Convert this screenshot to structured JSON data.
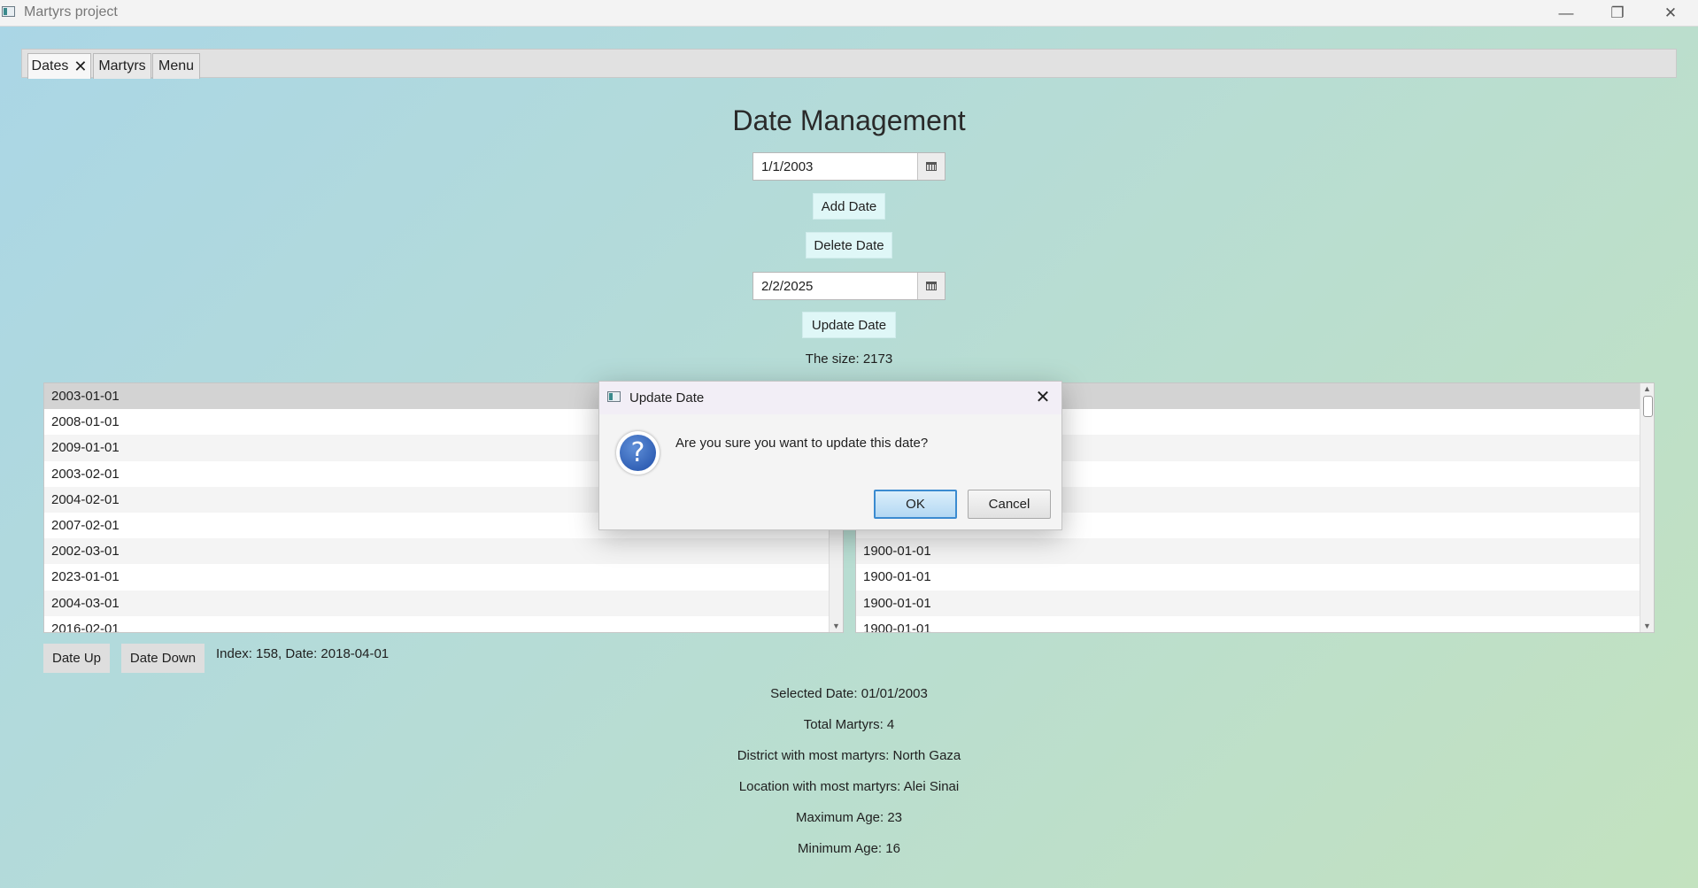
{
  "window": {
    "title": "Martyrs project",
    "controls": {
      "minimize": "—",
      "restore": "❐",
      "close": "✕"
    }
  },
  "tabs": [
    {
      "label": "Dates",
      "close": "✕",
      "active": true
    },
    {
      "label": "Martyrs"
    },
    {
      "label": "Menu"
    }
  ],
  "main": {
    "title": "Date Management",
    "date_input": "1/1/2003",
    "add_button": "Add Date",
    "delete_button": "Delete Date",
    "update_date_input": "2/2/2025",
    "update_button": "Update Date",
    "size_label": "The size: 2173"
  },
  "left_list": [
    "2003-01-01",
    "2008-01-01",
    "2009-01-01",
    "2003-02-01",
    "2004-02-01",
    "2007-02-01",
    "2002-03-01",
    "2023-01-01",
    "2004-03-01",
    "2016-02-01"
  ],
  "right_list": [
    "",
    "",
    "",
    "",
    "",
    "",
    "1900-01-01",
    "1900-01-01",
    "1900-01-01",
    "1900-01-01"
  ],
  "bottom": {
    "date_up": "Date Up",
    "date_down": "Date Down",
    "index_label": "Index: 158, Date: 2018-04-01",
    "selected_date": "Selected Date: 01/01/2003",
    "total_martyrs": "Total Martyrs: 4",
    "district": "District with most martyrs: North Gaza",
    "location": "Location with most martyrs: Alei Sinai",
    "max_age": "Maximum Age: 23",
    "min_age": "Minimum Age: 16"
  },
  "dialog": {
    "title": "Update Date",
    "close": "✕",
    "icon": "?",
    "message": "Are you sure you want to update this date?",
    "ok": "OK",
    "cancel": "Cancel"
  },
  "scroll_arrows": {
    "up": "▲",
    "down": "▼"
  }
}
